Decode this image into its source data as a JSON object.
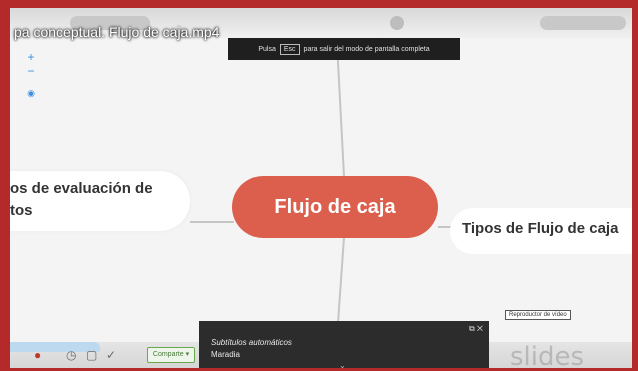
{
  "video": {
    "title": "pa conceptual. Flujo de caja.mp4"
  },
  "fullscreen_banner": {
    "before_key": "Pulsa",
    "key": "Esc",
    "after_key": "para salir del modo de pantalla completa"
  },
  "zoom": {
    "plus": "+",
    "minus": "−",
    "center": "◉"
  },
  "mindmap": {
    "center": "Flujo de caja",
    "left_line1": "os de evaluación de",
    "left_line2": "tos",
    "right": "Tipos de Flujo de caja"
  },
  "video_tooltip": "Reproductor de vídeo",
  "subtitles": {
    "header": "Subtítulos automáticos",
    "text": "Maradia",
    "controls": "⧉ ✕",
    "chevron": "⌄"
  },
  "toolbar": {
    "share_label": "Comparte ▾",
    "watermark": "slides"
  },
  "colors": {
    "center_node": "#dc5f4d",
    "frame": "#b42a2a",
    "zoom": "#3c8ddc"
  }
}
